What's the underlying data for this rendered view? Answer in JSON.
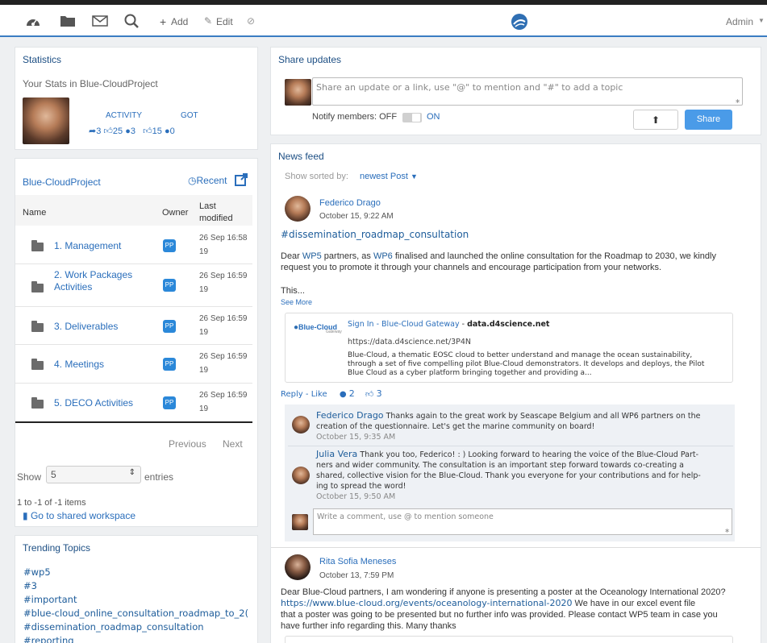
{
  "topbar": {
    "add_label": "Add",
    "edit_label": "Edit",
    "user_label": "Admin",
    "icons": [
      "dashboard-icon",
      "folder-icon",
      "mail-icon",
      "search-icon",
      "plus-icon",
      "edit-icon",
      "eye-slash-icon",
      "logo-icon"
    ]
  },
  "stats": {
    "title": "Statistics",
    "subtitle": "Your Stats in Blue-CloudProject",
    "activity_label": "ACTIVITY",
    "got_label": "GOT",
    "shares": "3",
    "likes": "25",
    "comments": "3",
    "got_likes": "15",
    "got_comments": "0"
  },
  "project": {
    "title": "Blue-CloudProject",
    "recent_label": "Recent",
    "columns": {
      "name": "Name",
      "owner": "Owner",
      "modified": "Last modified"
    },
    "rows": [
      {
        "name": "1. Management",
        "owner": "PP",
        "date": "26 Sep 16:58",
        "year": "19"
      },
      {
        "name": "2. Work Packages Activities",
        "owner": "PP",
        "date": "26 Sep 16:59",
        "year": "19"
      },
      {
        "name": "3. Deliverables",
        "owner": "PP",
        "date": "26 Sep 16:59",
        "year": "19"
      },
      {
        "name": "4. Meetings",
        "owner": "PP",
        "date": "26 Sep 16:59",
        "year": "19"
      },
      {
        "name": "5. DECO Activities",
        "owner": "PP",
        "date": "26 Sep 16:59",
        "year": "19"
      }
    ],
    "previous_label": "Previous",
    "next_label": "Next",
    "show_label": "Show",
    "show_value": "5",
    "entries_label": "entries",
    "count_text": "1 to -1 of -1 items",
    "workspace_link": "Go to shared workspace"
  },
  "trending": {
    "title": "Trending Topics",
    "tags": [
      "#wp5",
      "#3",
      "#important",
      "#blue-cloud_online_consultation_roadmap_to_2(",
      "#dissemination_roadmap_consultation",
      "#reporting"
    ]
  },
  "share": {
    "title": "Share updates",
    "placeholder": "Share an update or a link, use \"@\" to mention and \"#\" to add a topic",
    "notify_label": "Notify members: OFF",
    "on_label": "ON",
    "share_button": "Share"
  },
  "feed": {
    "title": "News feed",
    "sorted_label": "Show sorted by:",
    "sorted_value": "newest Post",
    "post1": {
      "author": "Federico Drago",
      "time": "October 15, 9:22 AM",
      "hashtag": "#dissemination_roadmap_consultation",
      "body_1": "Dear ",
      "body_wp5": "WP5",
      "body_2": " partners, as ",
      "body_wp6": "WP6",
      "body_3": " finalised and launched the online consultation for the Roadmap to 2030, we kindly",
      "body_4": "request you to promote it through your channels and encourage participation from your networks.",
      "this": "This...",
      "see_more": "See More",
      "preview": {
        "brand": "Blue-Cloud",
        "brand_sub": "Gateway",
        "title": "Sign In - Blue-Cloud Gateway",
        "domain": "data.d4science.net",
        "url": "https://data.d4science.net/3P4N",
        "desc_1": "Blue-Cloud, a thematic EOSC cloud to better understand and manage the ocean sustainability,",
        "desc_2": "through a set of five compelling pilot Blue-Cloud demonstrators. It develops and deploys, the Pilot",
        "desc_3": "Blue Cloud as a cyber platform bringing together and providing a..."
      },
      "reply_label": "Reply",
      "like_label": "Like",
      "comments_count": "2",
      "likes_count": "3",
      "comments": [
        {
          "author": "Federico Drago",
          "line1": "Thanks again to the great work by Seascape Belgium and all WP6 partners on the",
          "line2": "creation of the questionnaire. Let's get the marine community on board!",
          "time": "October 15, 9:35 AM"
        },
        {
          "author": "Julia Vera",
          "line1": "Thank you too, Federico! : ) Looking forward to hearing the voice of the Blue-Cloud Part-",
          "line2": "ners and wider community. The consultation is an important step forward towards co-creating a",
          "line3": "shared, collective vision for the Blue-Cloud. Thank you everyone for your contributions and for help-",
          "line4": "ing to spread the word!",
          "time": "October 15, 9:50 AM"
        }
      ],
      "comment_placeholder": "Write a comment, use @ to mention someone"
    },
    "post2": {
      "author": "Rita Sofia Meneses",
      "time": "October 13, 7:59 PM",
      "line1": "Dear Blue-Cloud partners, I am wondering if anyone is presenting a poster at the Oceanology International 2020?",
      "link": "https://www.blue-cloud.org/events/oceanology-international-2020",
      "line2_rest": " We have in our excel event file",
      "line3": "that a poster was going to be presented but no further info was provided. Please contact WP5 team in case you",
      "line4": "have further info regarding this. Many thanks"
    }
  }
}
